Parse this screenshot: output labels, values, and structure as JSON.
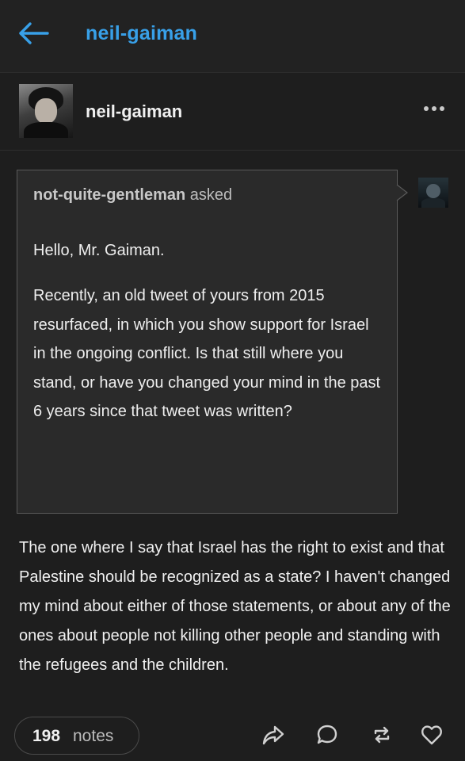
{
  "topbar": {
    "blog_title": "neil-gaiman"
  },
  "post": {
    "poster_name": "neil-gaiman",
    "ask": {
      "asker_name": "not-quite-gentleman",
      "asked_label": "asked",
      "greeting": "Hello, Mr. Gaiman.",
      "question": "Recently, an old tweet of yours from 2015 resurfaced, in which you show support for Israel in the ongoing conflict. Is that still where you stand, or have you changed your mind in the past 6 years since that tweet was written?"
    },
    "answer": "The one where I say that Israel has the right to exist and that Palestine should be recognized as a state? I haven't changed my mind about either of those statements, or about any of the ones about people not killing other people and standing with the refugees and the children."
  },
  "footer": {
    "notes_count": "198",
    "notes_label": "notes"
  },
  "icons": {
    "back": "back-arrow-icon",
    "more": "more-dots-icon",
    "share": "share-icon",
    "reply": "reply-icon",
    "reblog": "reblog-icon",
    "like": "heart-icon"
  },
  "colors": {
    "accent": "#38a0e8",
    "background": "#1e1e1e",
    "ask_background": "#2a2a2a"
  }
}
